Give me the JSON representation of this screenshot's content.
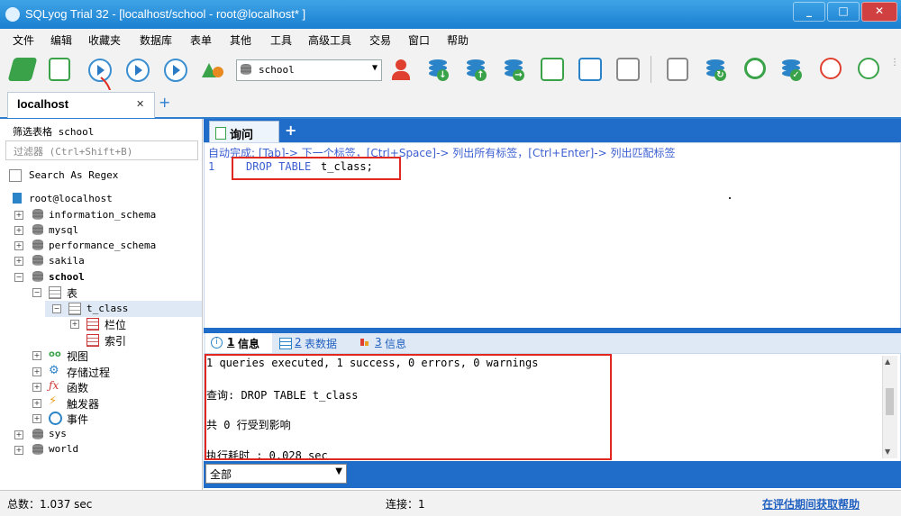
{
  "window": {
    "title": "SQLyog Trial 32 - [localhost/school - root@localhost* ]",
    "min": "_",
    "max": "□",
    "close": "✕"
  },
  "menu": [
    "文件",
    "编辑",
    "收藏夹",
    "数据库",
    "表单",
    "其他",
    "工具",
    "高级工具",
    "交易",
    "窗口",
    "帮助"
  ],
  "toolbar": {
    "database_select": "school",
    "execute_annotation": "执行"
  },
  "connection_tab": {
    "label": "localhost",
    "close": "✕",
    "add": "+"
  },
  "left": {
    "filter_label": "筛选表格 school",
    "filter_placeholder": "过滤器 (Ctrl+Shift+B)",
    "regex_label": "Search As Regex",
    "root": "root@localhost",
    "dbs": [
      "information_schema",
      "mysql",
      "performance_schema",
      "sakila",
      "school"
    ],
    "school_children": {
      "tables": "表",
      "table": "t_class",
      "columns": "栏位",
      "indexes": "索引",
      "views": "视图",
      "procedures": "存储过程",
      "functions": "函数",
      "triggers": "触发器",
      "events": "事件"
    },
    "more_dbs": [
      "sys",
      "world"
    ]
  },
  "query": {
    "tab_label": "询问",
    "add": "+",
    "hint": "自动完成: [Tab]-> 下一个标签，[Ctrl+Space]-> 列出所有标签，[Ctrl+Enter]-> 列出匹配标签",
    "line_no": "1",
    "keyword": "DROP TABLE",
    "identifier": "t_class;"
  },
  "results": {
    "tabs": [
      {
        "num": "1",
        "label": "信息"
      },
      {
        "num": "2",
        "label": "表数据"
      },
      {
        "num": "3",
        "label": "信息"
      }
    ],
    "lines": [
      "1 queries executed, 1 success, 0 errors, 0 warnings",
      "查询: DROP TABLE t_class",
      "共 0 行受到影响",
      "执行耗时   : 0.028 sec"
    ]
  },
  "filter_select": "全部",
  "status": {
    "total": "总数：1.037 sec",
    "connections": "连接：1",
    "help_link": "在评估期间获取帮助"
  },
  "colors": {
    "accent": "#1f6dc8",
    "highlight": "#e0281e",
    "keyword": "#3b5fd0"
  }
}
